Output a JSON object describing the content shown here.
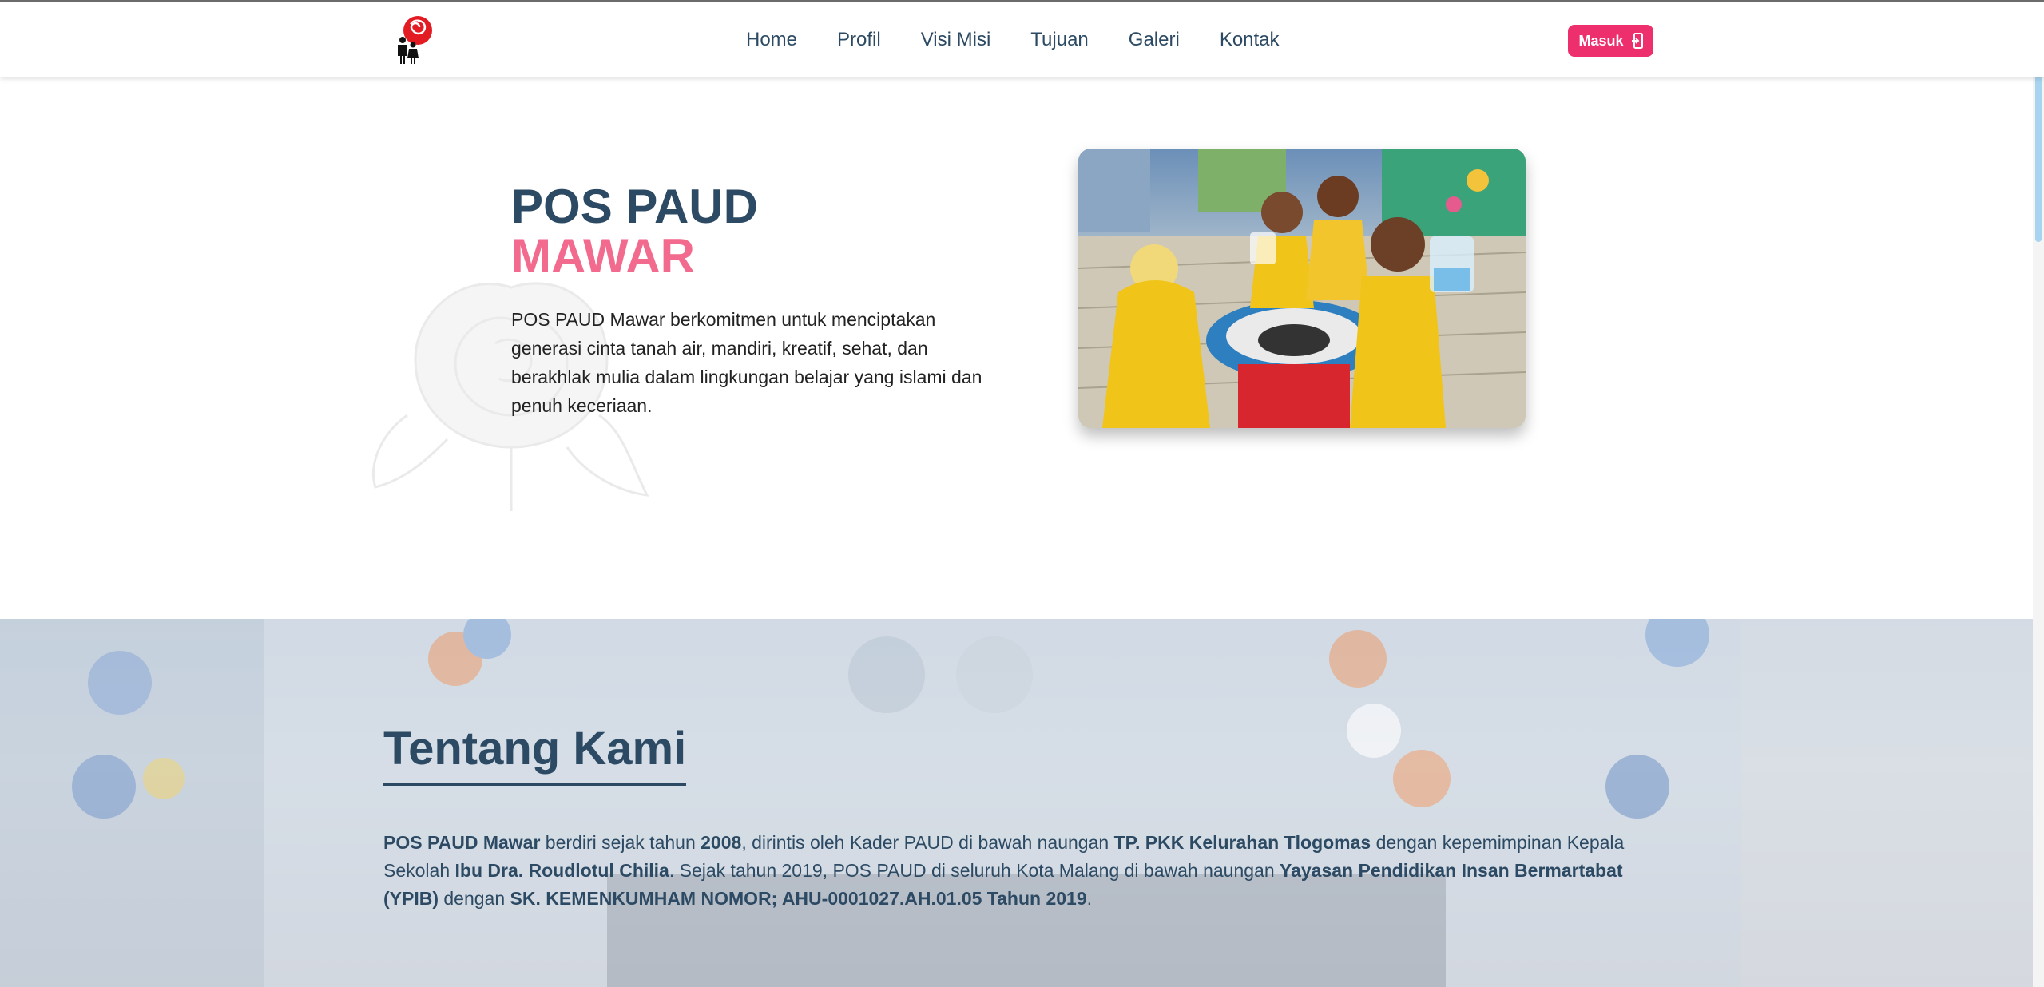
{
  "brand": {
    "logo_icon": "rose-family-logo-icon"
  },
  "nav": {
    "items": [
      {
        "label": "Home"
      },
      {
        "label": "Profil"
      },
      {
        "label": "Visi Misi"
      },
      {
        "label": "Tujuan"
      },
      {
        "label": "Galeri"
      },
      {
        "label": "Kontak"
      }
    ],
    "login_label": "Masuk",
    "login_icon": "login-door-icon"
  },
  "hero": {
    "title_line1": "POS PAUD",
    "title_line2": "MAWAR",
    "description": "POS PAUD Mawar berkomitmen untuk menciptakan generasi cinta tanah air, mandiri, kreatif, sehat, dan berakhlak mulia dalam lingkungan belajar yang islami dan penuh keceriaan.",
    "photo": "children-water-experiment-photo"
  },
  "about": {
    "title": "Tentang Kami",
    "text": {
      "p1": "POS PAUD Mawar",
      "p2": " berdiri sejak tahun ",
      "p3": "2008",
      "p4": ", dirintis oleh Kader PAUD di bawah naungan ",
      "p5": "TP. PKK Kelurahan Tlogomas",
      "p6": " dengan kepemimpinan Kepala Sekolah ",
      "p7": "Ibu Dra. Roudlotul Chilia",
      "p8": ". Sejak tahun 2019, POS PAUD di seluruh Kota Malang di bawah naungan ",
      "p9": "Yayasan Pendidikan Insan Bermartabat (YPIB)",
      "p10": " dengan ",
      "p11": "SK. KEMENKUMHAM NOMOR; AHU-0001027.AH.01.05 Tahun 2019",
      "p12": "."
    }
  },
  "colors": {
    "navy": "#2c4a63",
    "pink": "#f26a8d",
    "button": "#ee2f6e"
  }
}
